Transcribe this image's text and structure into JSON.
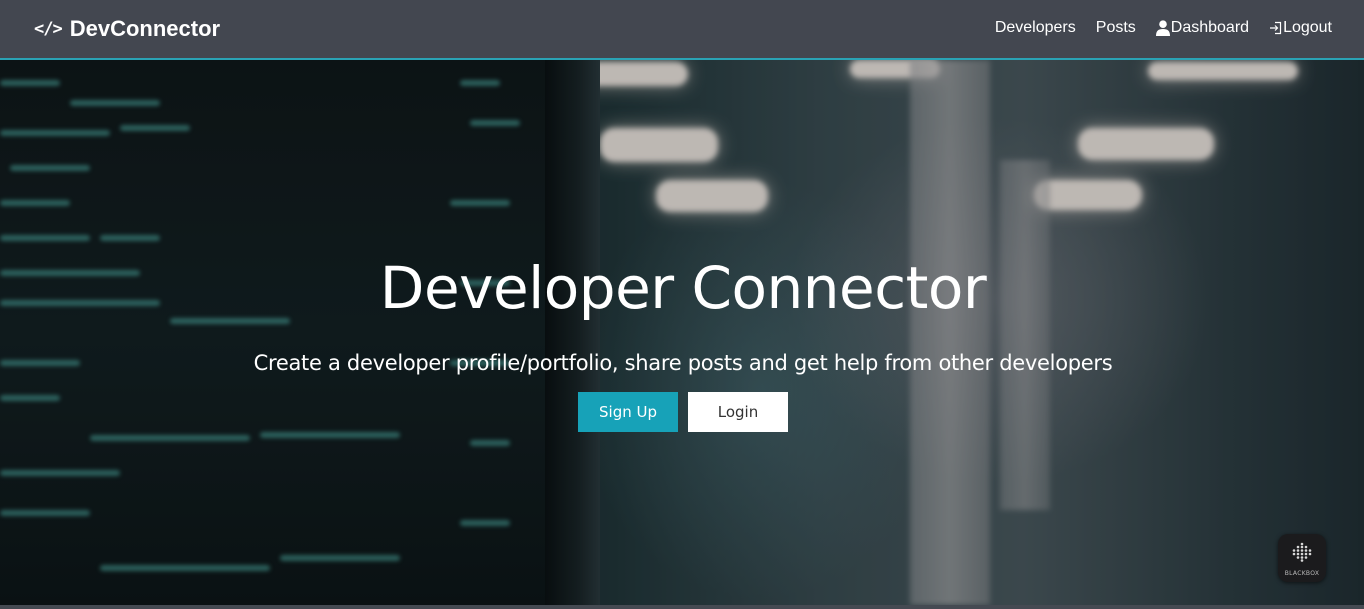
{
  "navbar": {
    "brand": {
      "icon": "code-icon",
      "icon_glyph": "</>",
      "label": "DevConnector"
    },
    "links": {
      "developers": "Developers",
      "posts": "Posts",
      "dashboard": "Dashboard",
      "logout": "Logout"
    },
    "icons": {
      "dashboard": "user-icon",
      "logout": "sign-out-icon"
    }
  },
  "hero": {
    "title": "Developer Connector",
    "subtitle": "Create a developer profile/portfolio, share posts and get help from other developers",
    "buttons": {
      "signup": "Sign Up",
      "login": "Login"
    }
  },
  "widget": {
    "label": "BLACKBOX",
    "icon": "blackbox-logo-icon"
  },
  "colors": {
    "navbar_bg": "#434750",
    "accent": "#17a2b8",
    "login_bg": "#ffffff"
  }
}
